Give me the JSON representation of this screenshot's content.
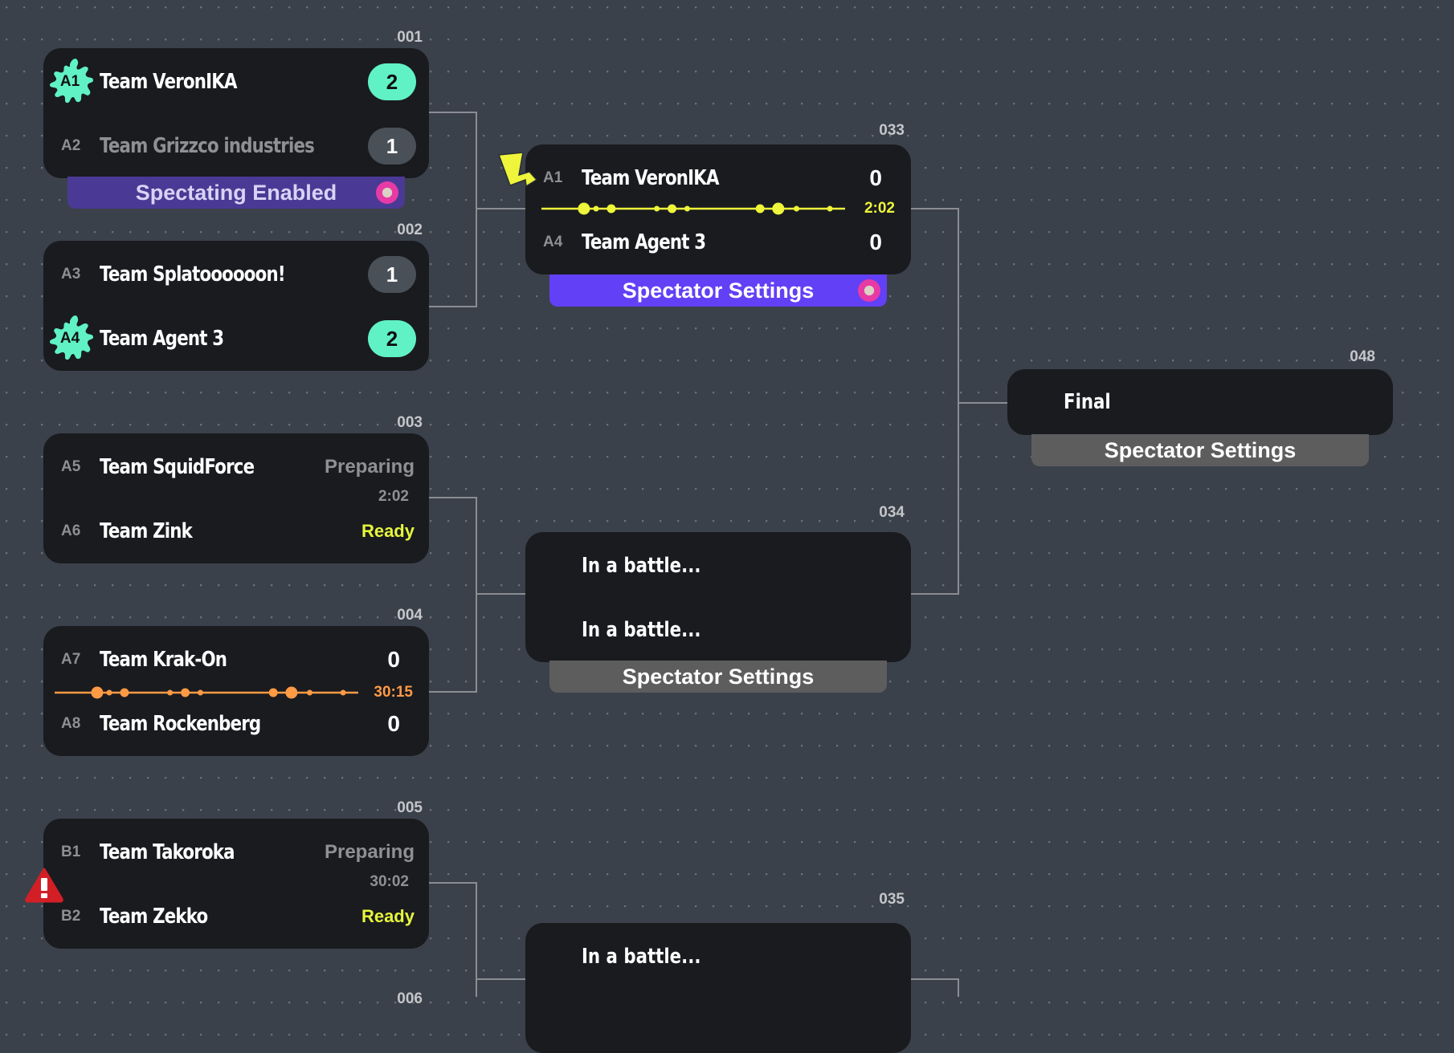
{
  "colors": {
    "background": "#3b414b",
    "card": "#191b1f",
    "win_pill": "#60f2c4",
    "lose_pill": "#4a5058",
    "ready": "#e6f53c",
    "live_yellow": "#eef53a",
    "live_orange": "#ff9a45",
    "spectating_enabled": "#4a3a95",
    "spectator_active": "#6240f5",
    "spectator_disabled": "#5d5d5d",
    "warning": "#d21f25",
    "connector": "#8a8d92"
  },
  "round1": [
    {
      "id": "001",
      "teams": [
        {
          "seed": "A1",
          "name": "Team VeronIKA",
          "score": "2",
          "winner": true
        },
        {
          "seed": "A2",
          "name": "Team Grizzco industries",
          "score": "1",
          "winner": false
        }
      ],
      "spectator_bar": {
        "label": "Spectating Enabled",
        "state": "enabled",
        "avatar": true
      }
    },
    {
      "id": "002",
      "teams": [
        {
          "seed": "A3",
          "name": "Team Splatoooooon!",
          "score": "1",
          "winner": false
        },
        {
          "seed": "A4",
          "name": "Team Agent 3",
          "score": "2",
          "winner": true
        }
      ]
    },
    {
      "id": "003",
      "teams": [
        {
          "seed": "A5",
          "name": "Team SquidForce",
          "status": "Preparing"
        },
        {
          "seed": "A6",
          "name": "Team Zink",
          "status": "Ready"
        }
      ],
      "timer": "2:02"
    },
    {
      "id": "004",
      "teams": [
        {
          "seed": "A7",
          "name": "Team Krak-On",
          "score": "0"
        },
        {
          "seed": "A8",
          "name": "Team Rockenberg",
          "score": "0"
        }
      ],
      "live_timer": "30:15",
      "timeline_events": [
        0.14,
        0.18,
        0.23,
        0.38,
        0.43,
        0.48,
        0.72,
        0.78,
        0.84,
        0.95
      ],
      "timeline_event_sizes": [
        "large",
        "small",
        "medium",
        "small",
        "medium",
        "small",
        "medium",
        "large",
        "small",
        "small"
      ]
    },
    {
      "id": "005",
      "teams": [
        {
          "seed": "B1",
          "name": "Team Takoroka",
          "status": "Preparing"
        },
        {
          "seed": "B2",
          "name": "Team Zekko",
          "status": "Ready"
        }
      ],
      "timer": "30:02",
      "warning": true
    }
  ],
  "round2": [
    {
      "id": "033",
      "teams": [
        {
          "seed": "A1",
          "name": "Team VeronIKA",
          "score": "0"
        },
        {
          "seed": "A4",
          "name": "Team Agent 3",
          "score": "0"
        }
      ],
      "live_timer": "2:02",
      "timeline_events": [
        0.14,
        0.18,
        0.23,
        0.38,
        0.43,
        0.48,
        0.72,
        0.78,
        0.84,
        0.95
      ],
      "timeline_event_sizes": [
        "large",
        "small",
        "medium",
        "small",
        "medium",
        "small",
        "medium",
        "large",
        "small",
        "small"
      ],
      "spectator_bar": {
        "label": "Spectator Settings",
        "state": "active",
        "avatar": true
      }
    },
    {
      "id": "034",
      "slots": [
        "In a battle...",
        "In a battle..."
      ],
      "spectator_bar": {
        "label": "Spectator Settings",
        "state": "disabled"
      }
    },
    {
      "id": "035",
      "slots": [
        "In a battle..."
      ]
    }
  ],
  "final": {
    "id": "048",
    "label": "Final",
    "spectator_bar": {
      "label": "Spectator Settings",
      "state": "disabled"
    }
  },
  "partial_label": "006"
}
